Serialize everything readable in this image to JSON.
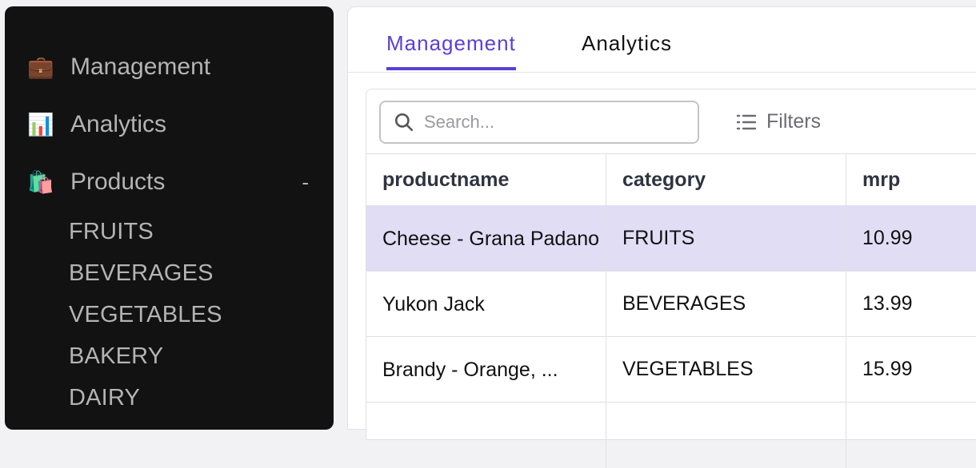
{
  "sidebar": {
    "items": [
      {
        "label": "Management",
        "icon": "briefcase-icon"
      },
      {
        "label": "Analytics",
        "icon": "bar-chart-icon"
      },
      {
        "label": "Products",
        "icon": "shopping-bags-icon",
        "toggle": "-"
      }
    ],
    "sub_items": [
      "FRUITS",
      "BEVERAGES",
      "VEGETABLES",
      "BAKERY",
      "DAIRY"
    ]
  },
  "tabs": [
    {
      "label": "Management",
      "active": true
    },
    {
      "label": "Analytics",
      "active": false
    }
  ],
  "search": {
    "placeholder": "Search..."
  },
  "filters_label": "Filters",
  "table": {
    "columns": [
      "productname",
      "category",
      "mrp"
    ],
    "rows": [
      {
        "productname": "Cheese - Grana Padano",
        "category": "FRUITS",
        "mrp": "10.99",
        "selected": true
      },
      {
        "productname": "Yukon Jack",
        "category": "BEVERAGES",
        "mrp": "13.99",
        "selected": false
      },
      {
        "productname": "Brandy - Orange, ...",
        "category": "VEGETABLES",
        "mrp": "15.99",
        "selected": false
      }
    ]
  },
  "colors": {
    "accent": "#5b3fd6",
    "selected_row": "#e1ddf5",
    "sidebar_bg": "#121212"
  }
}
